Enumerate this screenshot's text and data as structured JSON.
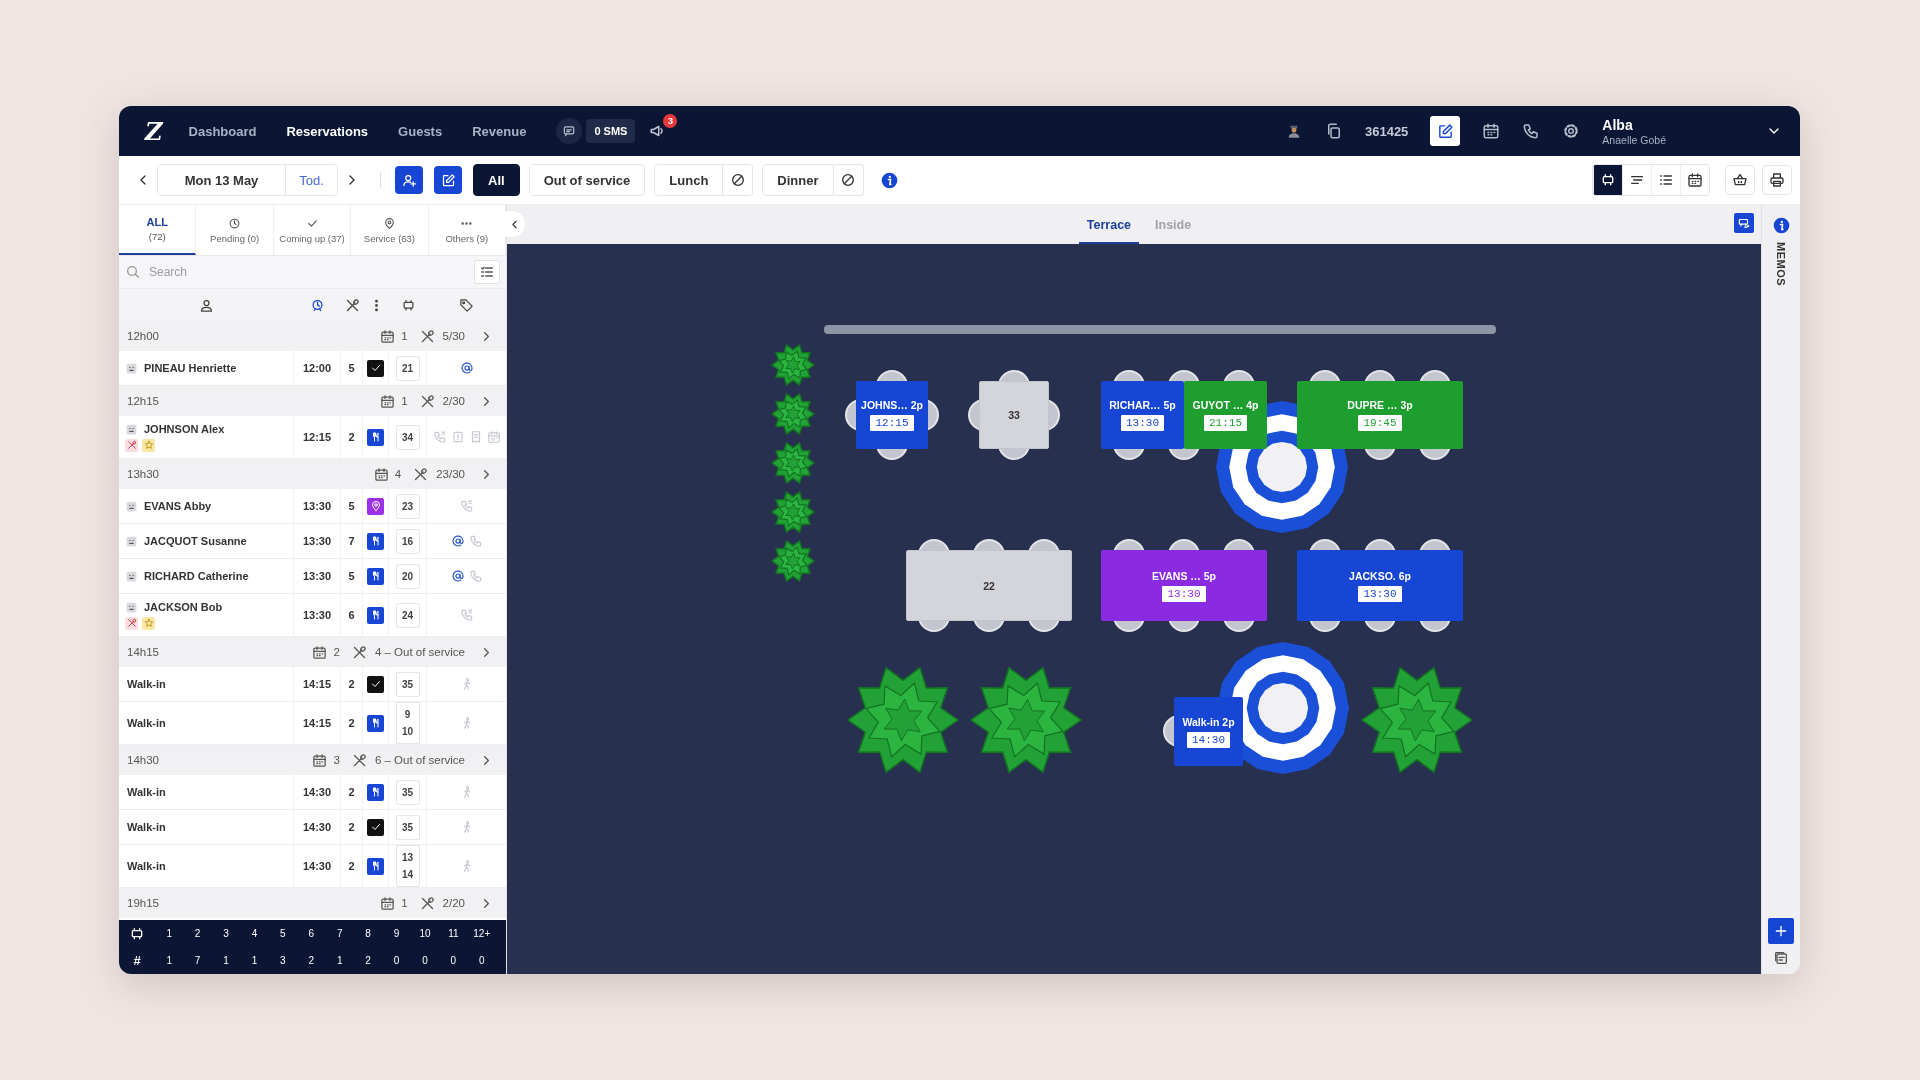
{
  "header": {
    "logo": "Z",
    "nav": [
      {
        "label": "Dashboard",
        "selected": false
      },
      {
        "label": "Reservations",
        "selected": true
      },
      {
        "label": "Guests",
        "selected": false
      },
      {
        "label": "Revenue",
        "selected": false
      }
    ],
    "sms": "0 SMS",
    "notifications": "3",
    "account_number": "361425",
    "user": {
      "name": "Alba",
      "subtitle": "Anaelle Gobé"
    }
  },
  "toolbar": {
    "date": "Mon 13 May",
    "today": "Tod.",
    "filters": [
      {
        "label": "All",
        "selected": true,
        "kind": "plain"
      },
      {
        "label": "Out of service",
        "selected": false,
        "kind": "plain"
      },
      {
        "label": "Lunch",
        "selected": false,
        "kind": "service"
      },
      {
        "label": "Dinner",
        "selected": false,
        "kind": "service"
      }
    ],
    "views": [
      {
        "kind": "floor",
        "selected": true
      },
      {
        "kind": "timeline",
        "selected": false
      },
      {
        "kind": "list",
        "selected": false
      },
      {
        "kind": "calendar",
        "selected": false
      }
    ]
  },
  "list": {
    "tabs": [
      {
        "kind": "all",
        "label": "ALL",
        "count": "(72)",
        "selected": true
      },
      {
        "kind": "pending",
        "label": "Pending (0)",
        "selected": false
      },
      {
        "kind": "coming",
        "label": "Coming up (37)",
        "selected": false
      },
      {
        "kind": "service",
        "label": "Service (63)",
        "selected": false
      },
      {
        "kind": "others",
        "label": "Others (9)",
        "selected": false
      }
    ],
    "search": {
      "placeholder": "Search"
    },
    "groups": [
      {
        "time": "12h00",
        "bookings": "1",
        "covers": "5/30",
        "rows": [
          {
            "kind": "guest",
            "name": "PINEAU Henriette",
            "time": "12:00",
            "covers": "5",
            "status": {
              "kind": "check"
            },
            "tables": [
              "21"
            ],
            "contacts": [
              {
                "kind": "email"
              }
            ]
          }
        ]
      },
      {
        "time": "12h15",
        "bookings": "1",
        "covers": "2/30",
        "rows": [
          {
            "kind": "guest",
            "name": "JOHNSON Alex",
            "tags": [
              {
                "kind": "allergy"
              },
              {
                "kind": "vip"
              }
            ],
            "time": "12:15",
            "covers": "2",
            "status": {
              "kind": "cutlery"
            },
            "tables": [
              "34"
            ],
            "contacts": [
              {
                "kind": "phone_missed"
              },
              {
                "kind": "note"
              },
              {
                "kind": "receipt"
              },
              {
                "kind": "calendar"
              }
            ]
          }
        ]
      },
      {
        "time": "13h30",
        "bookings": "4",
        "covers": "23/30",
        "rows": [
          {
            "kind": "guest",
            "name": "EVANS Abby",
            "time": "13:30",
            "covers": "5",
            "status": {
              "kind": "pin"
            },
            "tables": [
              "23"
            ],
            "contacts": [
              {
                "kind": "phone_missed"
              }
            ]
          },
          {
            "kind": "guest",
            "name": "JACQUOT Susanne",
            "time": "13:30",
            "covers": "7",
            "status": {
              "kind": "cutlery"
            },
            "tables": [
              "16"
            ],
            "contacts": [
              {
                "kind": "email"
              },
              {
                "kind": "phone"
              }
            ]
          },
          {
            "kind": "guest",
            "name": "RICHARD Catherine",
            "time": "13:30",
            "covers": "5",
            "status": {
              "kind": "cutlery"
            },
            "tables": [
              "20"
            ],
            "contacts": [
              {
                "kind": "email"
              },
              {
                "kind": "phone"
              }
            ]
          },
          {
            "kind": "guest",
            "name": "JACKSON Bob",
            "tags": [
              {
                "kind": "allergy"
              },
              {
                "kind": "vip"
              }
            ],
            "time": "13:30",
            "covers": "6",
            "status": {
              "kind": "cutlery"
            },
            "tables": [
              "24"
            ],
            "contacts": [
              {
                "kind": "phone_missed"
              }
            ]
          }
        ]
      },
      {
        "time": "14h15",
        "bookings": "2",
        "covers": "4 – Out of service",
        "rows": [
          {
            "kind": "walk_in",
            "name": "Walk-in",
            "time": "14:15",
            "covers": "2",
            "status": {
              "kind": "check"
            },
            "tables": [
              "35"
            ],
            "contacts": [
              {
                "kind": "walk"
              }
            ]
          },
          {
            "kind": "walk_in",
            "name": "Walk-in",
            "time": "14:15",
            "covers": "2",
            "status": {
              "kind": "cutlery"
            },
            "tables": [
              "9",
              "10"
            ],
            "contacts": [
              {
                "kind": "walk"
              }
            ]
          }
        ]
      },
      {
        "time": "14h30",
        "bookings": "3",
        "covers": "6 – Out of service",
        "rows": [
          {
            "kind": "walk_in",
            "name": "Walk-in",
            "time": "14:30",
            "covers": "2",
            "status": {
              "kind": "cutlery"
            },
            "tables": [
              "35"
            ],
            "contacts": [
              {
                "kind": "walk"
              }
            ]
          },
          {
            "kind": "walk_in",
            "name": "Walk-in",
            "time": "14:30",
            "covers": "2",
            "status": {
              "kind": "check"
            },
            "tables": [
              "35"
            ],
            "contacts": [
              {
                "kind": "walk"
              }
            ]
          },
          {
            "kind": "walk_in",
            "name": "Walk-in",
            "time": "14:30",
            "covers": "2",
            "status": {
              "kind": "cutlery"
            },
            "tables": [
              "13",
              "14"
            ],
            "contacts": [
              {
                "kind": "walk"
              }
            ]
          }
        ]
      },
      {
        "time": "19h15",
        "bookings": "1",
        "covers": "2/20"
      }
    ],
    "footer": {
      "sizes": [
        "1",
        "2",
        "3",
        "4",
        "5",
        "6",
        "7",
        "8",
        "9",
        "10",
        "11",
        "12+"
      ],
      "symbol": "#",
      "counts": [
        "1",
        "7",
        "1",
        "1",
        "3",
        "2",
        "1",
        "2",
        "0",
        "0",
        "0",
        "0"
      ]
    }
  },
  "floor": {
    "tabs": [
      {
        "label": "Terrace",
        "selected": true
      },
      {
        "label": "Inside",
        "selected": false
      }
    ],
    "tables": [
      {
        "kind": "booked",
        "label": "JOHNS… 2p",
        "time": "12:15",
        "color": "#1746d4"
      },
      {
        "kind": "free",
        "label": "33"
      },
      {
        "kind": "booked",
        "label": "RICHAR… 5p",
        "time": "13:30",
        "color": "#1746d4"
      },
      {
        "kind": "booked",
        "label": "GUYOT … 4p",
        "time": "21:15",
        "color": "#1f9e30"
      },
      {
        "kind": "booked",
        "label": "DUPRE … 3p",
        "time": "19:45",
        "color": "#1f9e30"
      },
      {
        "kind": "free",
        "label": "22"
      },
      {
        "kind": "booked",
        "label": "EVANS … 5p",
        "time": "13:30",
        "color": "#8a2be2"
      },
      {
        "kind": "booked",
        "label": "JACKSO. 6p",
        "time": "13:30",
        "color": "#1746d4"
      },
      {
        "kind": "booked",
        "label": "Walk-in 2p",
        "time": "14:30",
        "color": "#1746d4"
      }
    ]
  },
  "memos": {
    "label": "MEMOS"
  }
}
